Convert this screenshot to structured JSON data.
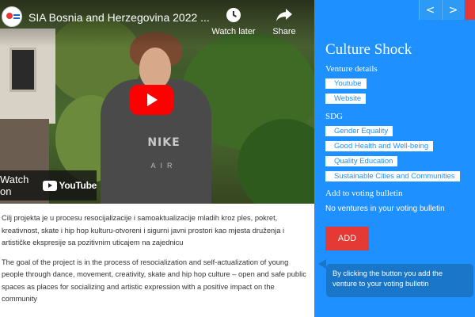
{
  "video": {
    "title": "SIA Bosnia and Herzegovina 2022 ...",
    "watch_later_label": "Watch later",
    "share_label": "Share",
    "watch_on_label": "Watch on",
    "youtube_brand": "YouTube",
    "shirt_brand": "NIKE",
    "shirt_sub": "AIR"
  },
  "description": {
    "local": "Cilj projekta je u procesu resocijalizacije i samoaktualizacije mladih kroz ples, pokret, kreativnost, skate i hip hop kulturu-otvoreni i sigurni javni prostori kao mjesta druženja i artističke ekspresije sa pozitivnim uticajem na zajednicu",
    "english": "The goal of the project is in the process of resocialization and self-actualization of young people through dance, movement, creativity, skate and hip hop culture – open and safe public spaces as places for socializing and artistic expression with a positive impact on the community"
  },
  "sidebar": {
    "nav_prev": "<",
    "nav_next": ">",
    "title": "Culture Shock",
    "venture_details_label": "Venture details",
    "venture_links": [
      "Youtube",
      "Website"
    ],
    "sdg_label": "SDG",
    "sdg_tags": [
      "Gender Equality",
      "Good Health and Well-being",
      "Quality Education",
      "Sustainable Cities and Communities"
    ],
    "voting_label": "Add to voting bulletin",
    "voting_empty": "No ventures in your voting bulletin",
    "add_button": "ADD",
    "tooltip": "By clicking the button you add the venture to your voting bulletin"
  },
  "colors": {
    "sidebar_bg": "#1e90ff",
    "add_button": "#e53935",
    "tooltip_bg": "#1976c8",
    "youtube_red": "#ff0000"
  }
}
